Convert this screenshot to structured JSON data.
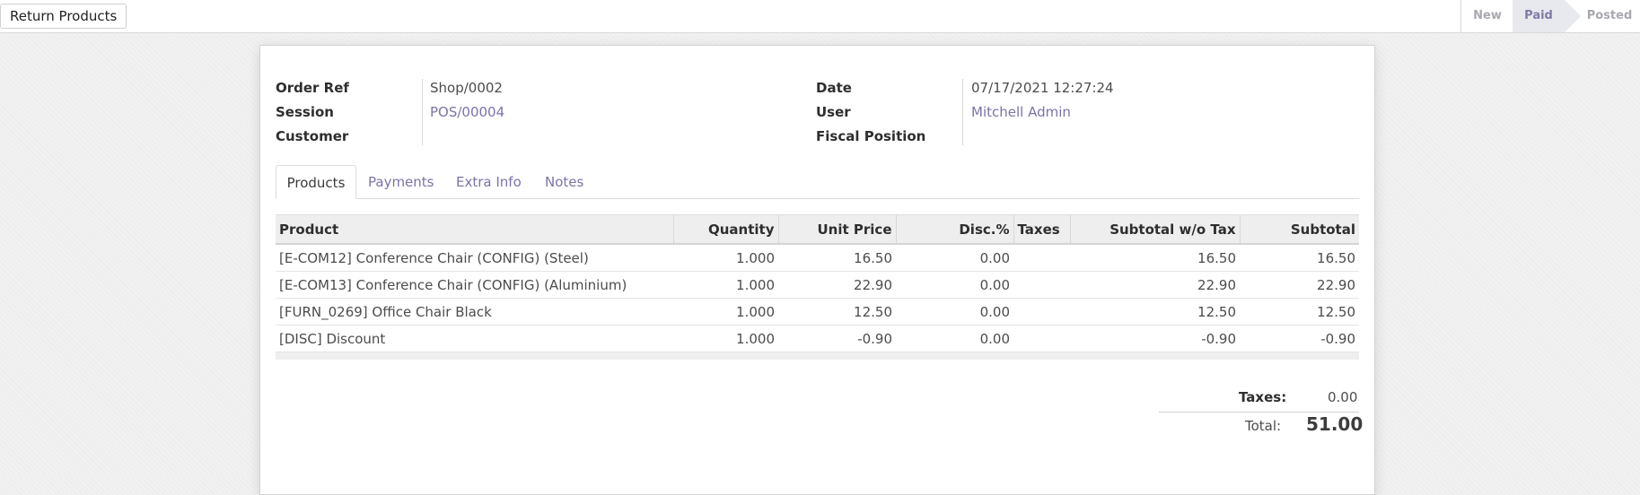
{
  "toolbar": {
    "return_label": "Return Products"
  },
  "statusbar": {
    "stages": [
      "New",
      "Paid",
      "Posted"
    ],
    "active_stage": "Paid"
  },
  "order": {
    "order_ref_label": "Order Ref",
    "order_ref": "Shop/0002",
    "session_label": "Session",
    "session": "POS/00004",
    "customer_label": "Customer",
    "customer": "",
    "date_label": "Date",
    "date": "07/17/2021 12:27:24",
    "user_label": "User",
    "user": "Mitchell Admin",
    "fiscal_position_label": "Fiscal Position",
    "fiscal_position": ""
  },
  "tabs": [
    "Products",
    "Payments",
    "Extra Info",
    "Notes"
  ],
  "lines": {
    "columns": [
      "Product",
      "Quantity",
      "Unit Price",
      "Disc.%",
      "Taxes",
      "Subtotal w/o Tax",
      "Subtotal"
    ],
    "rows": [
      [
        "[E-COM12] Conference Chair (CONFIG) (Steel)",
        "1.000",
        "16.50",
        "0.00",
        "",
        "16.50",
        "16.50"
      ],
      [
        "[E-COM13] Conference Chair (CONFIG) (Aluminium)",
        "1.000",
        "22.90",
        "0.00",
        "",
        "22.90",
        "22.90"
      ],
      [
        "[FURN_0269] Office Chair Black",
        "1.000",
        "12.50",
        "0.00",
        "",
        "12.50",
        "12.50"
      ],
      [
        "[DISC] Discount",
        "1.000",
        "-0.90",
        "0.00",
        "",
        "-0.90",
        "-0.90"
      ]
    ]
  },
  "totals": {
    "taxes_label": "Taxes:",
    "taxes": "0.00",
    "total_label": "Total:",
    "total": "51.00"
  },
  "colors": {
    "link": "#7a74a8",
    "active_stage_bg": "#e8e8ef"
  }
}
